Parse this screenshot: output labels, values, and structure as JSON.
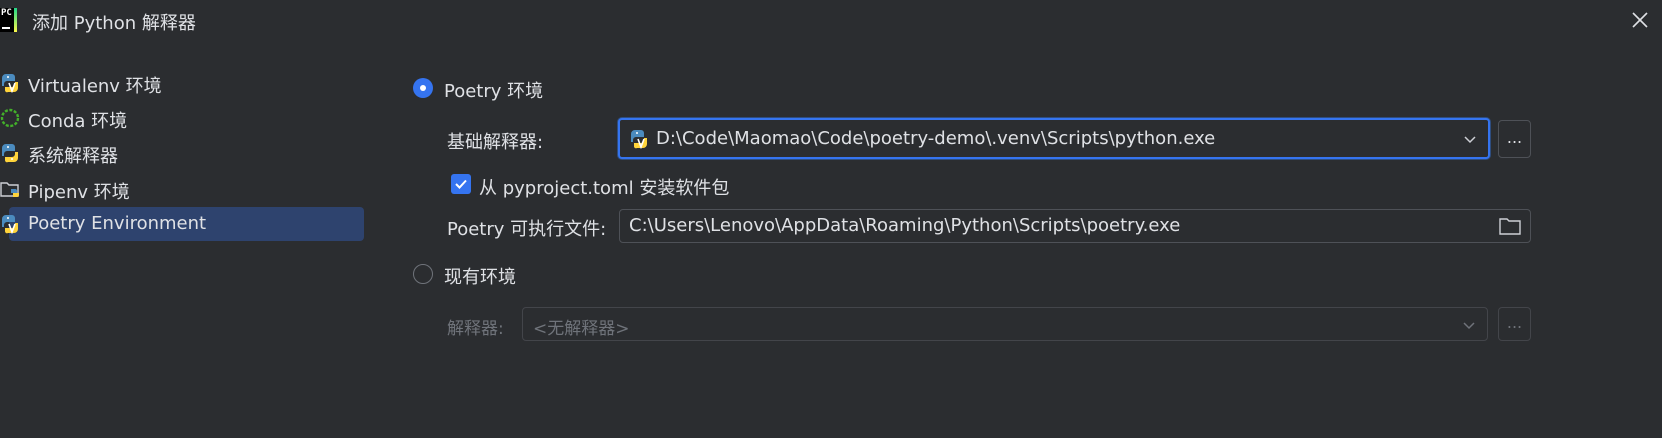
{
  "window": {
    "title": "添加 Python 解释器",
    "app_icon_text": "PC"
  },
  "sidebar": {
    "items": [
      {
        "label": "Virtualenv 环境",
        "icon": "python-virtualenv-icon"
      },
      {
        "label": "Conda 环境",
        "icon": "conda-icon"
      },
      {
        "label": "系统解释器",
        "icon": "python-icon"
      },
      {
        "label": "Pipenv 环境",
        "icon": "pipenv-folder-icon"
      },
      {
        "label": "Poetry Environment",
        "icon": "poetry-icon",
        "selected": true
      }
    ]
  },
  "main": {
    "poetry_option": {
      "label": "Poetry 环境",
      "selected": true,
      "base_interpreter_label": "基础解释器:",
      "base_interpreter_value": "D:\\Code\\Maomao\\Code\\poetry-demo\\.venv\\Scripts\\python.exe",
      "browse_label": "...",
      "install_checkbox_label": "从 pyproject.toml 安装软件包",
      "install_checked": true,
      "executable_label": "Poetry 可执行文件:",
      "executable_value": "C:\\Users\\Lenovo\\AppData\\Roaming\\Python\\Scripts\\poetry.exe"
    },
    "existing_option": {
      "label": "现有环境",
      "selected": false,
      "interpreter_label": "解释器:",
      "interpreter_value": "<无解释器>",
      "browse_label": "..."
    }
  },
  "colors": {
    "background": "#2b2d30",
    "accent": "#3574f0",
    "selection": "#2e436e",
    "text": "#dfe1e5",
    "muted_text": "#6f737a"
  }
}
